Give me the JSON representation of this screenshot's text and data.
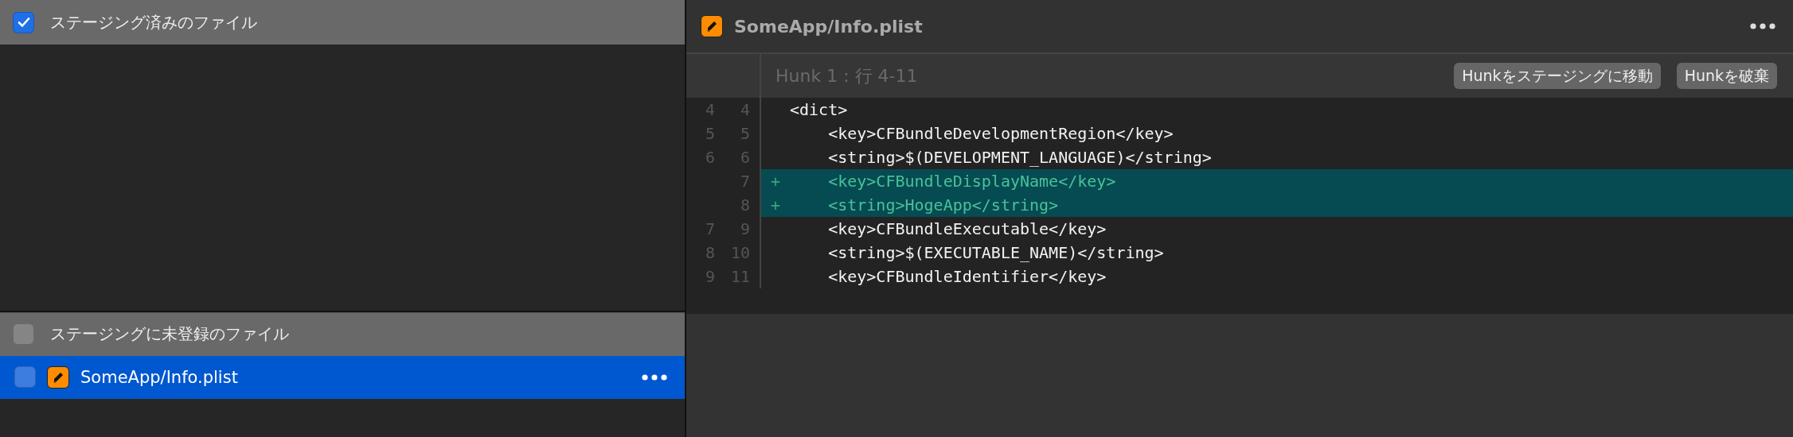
{
  "staged": {
    "checked": true,
    "title": "ステージング済みのファイル"
  },
  "unstaged": {
    "checked": false,
    "title": "ステージングに未登録のファイル",
    "files": [
      {
        "name": "SomeApp/Info.plist",
        "checked": false,
        "selected": true
      }
    ]
  },
  "diff": {
    "file": "SomeApp/Info.plist",
    "hunk_title": "Hunk 1 : 行 4-11",
    "buttons": [
      "Hunkをステージングに移動",
      "Hunkを破棄"
    ],
    "lines": [
      {
        "kind": "context",
        "old": "4",
        "new": "4",
        "text": "<dict>"
      },
      {
        "kind": "context",
        "old": "5",
        "new": "5",
        "text": "    <key>CFBundleDevelopmentRegion</key>"
      },
      {
        "kind": "context",
        "old": "6",
        "new": "6",
        "text": "    <string>$(DEVELOPMENT_LANGUAGE)</string>"
      },
      {
        "kind": "added",
        "new": "7",
        "marker": "+",
        "text": "    <key>CFBundleDisplayName</key>"
      },
      {
        "kind": "added",
        "new": "8",
        "marker": "+",
        "text": "    <string>HogeApp</string>"
      },
      {
        "kind": "context",
        "old": "7",
        "new": "9",
        "text": "    <key>CFBundleExecutable</key>"
      },
      {
        "kind": "context",
        "old": "8",
        "new": "10",
        "text": "    <string>$(EXECUTABLE_NAME)</string>"
      },
      {
        "kind": "context",
        "old": "9",
        "new": "11",
        "text": "    <key>CFBundleIdentifier</key>"
      }
    ]
  }
}
